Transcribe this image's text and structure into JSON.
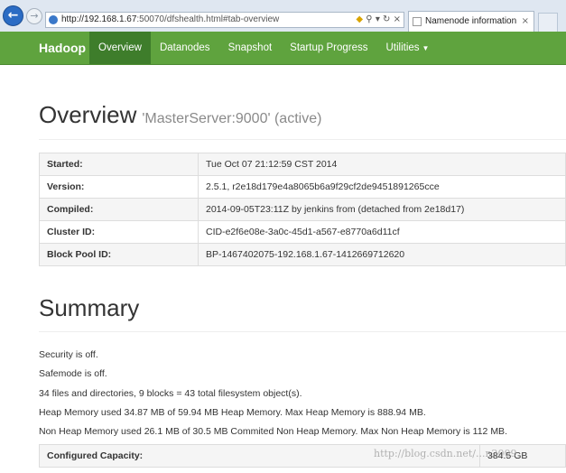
{
  "browser": {
    "url_host": "http://192.168.1.67",
    "url_rest": ":50070/dfshealth.html#tab-overview",
    "tab_title": "Namenode information",
    "back_glyph": "←",
    "forward_glyph": "→",
    "close_glyph": "×"
  },
  "navbar": {
    "brand": "Hadoop",
    "items": [
      {
        "label": "Overview"
      },
      {
        "label": "Datanodes"
      },
      {
        "label": "Snapshot"
      },
      {
        "label": "Startup Progress"
      },
      {
        "label": "Utilities"
      }
    ]
  },
  "overview": {
    "title": "Overview",
    "subtitle": "'MasterServer:9000' (active)",
    "rows": [
      {
        "label": "Started:",
        "value": "Tue Oct 07 21:12:59 CST 2014"
      },
      {
        "label": "Version:",
        "value": "2.5.1, r2e18d179e4a8065b6a9f29cf2de9451891265cce"
      },
      {
        "label": "Compiled:",
        "value": "2014-09-05T23:11Z by jenkins from (detached from 2e18d17)"
      },
      {
        "label": "Cluster ID:",
        "value": "CID-e2f6e08e-3a0c-45d1-a567-e8770a6d11cf"
      },
      {
        "label": "Block Pool ID:",
        "value": "BP-1467402075-192.168.1.67-1412669712620"
      }
    ]
  },
  "summary": {
    "title": "Summary",
    "lines": [
      "Security is off.",
      "Safemode is off.",
      "34 files and directories, 9 blocks = 43 total filesystem object(s).",
      "Heap Memory used 34.87 MB of 59.94 MB Heap Memory. Max Heap Memory is 888.94 MB.",
      "Non Heap Memory used 26.1 MB of 30.5 MB Commited Non Heap Memory. Max Non Heap Memory is 112 MB."
    ],
    "capacity_label": "Configured Capacity:",
    "capacity_value": "384.5 GB"
  },
  "watermark": "http://blog.csdn.net/...n2009"
}
